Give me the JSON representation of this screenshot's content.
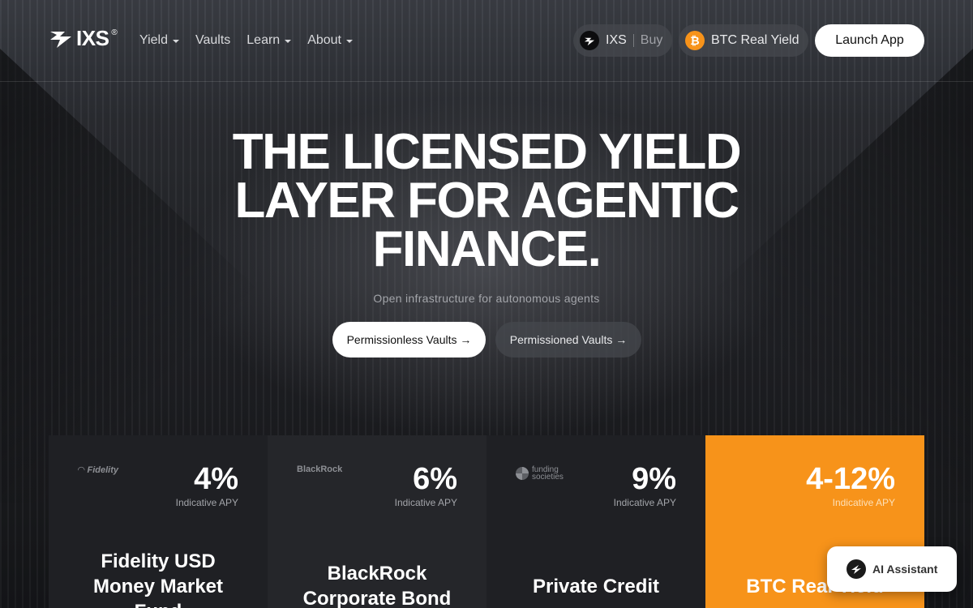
{
  "nav": {
    "logo_text": "IXS",
    "logo_reg": "®",
    "menu": [
      {
        "label": "Yield",
        "has_dropdown": true
      },
      {
        "label": "Vaults",
        "has_dropdown": false
      },
      {
        "label": "Learn",
        "has_dropdown": true
      },
      {
        "label": "About",
        "has_dropdown": true
      }
    ],
    "token_pill": {
      "symbol": "IXS",
      "action": "Buy"
    },
    "btc_pill": {
      "coin_glyph": "₿",
      "label": "BTC Real Yield"
    },
    "launch_label": "Launch App"
  },
  "hero": {
    "headline": "THE LICENSED YIELD\nLAYER FOR AGENTIC\nFINANCE.",
    "subline": "Open infrastructure for autonomous agents",
    "cta_primary": "Permissionless Vaults →",
    "cta_secondary": "Permissioned Vaults →"
  },
  "cards": [
    {
      "logo": "Fidelity",
      "rate": "4%",
      "apy_label": "Indicative APY",
      "name": "Fidelity USD\nMoney Market\nFund"
    },
    {
      "logo": "BlackRock",
      "rate": "6%",
      "apy_label": "Indicative APY",
      "name": "BlackRock\nCorporate Bond"
    },
    {
      "logo": "funding\nsocieties",
      "rate": "9%",
      "apy_label": "Indicative APY",
      "name": "Private Credit"
    },
    {
      "logo": "",
      "rate": "4-12%",
      "apy_label": "Indicative APY",
      "name": "BTC Real Yield"
    }
  ],
  "assistant": {
    "label": "AI Assistant"
  },
  "colors": {
    "accent_orange": "#f7931a",
    "bg_dark": "#1f2024",
    "white": "#ffffff"
  }
}
